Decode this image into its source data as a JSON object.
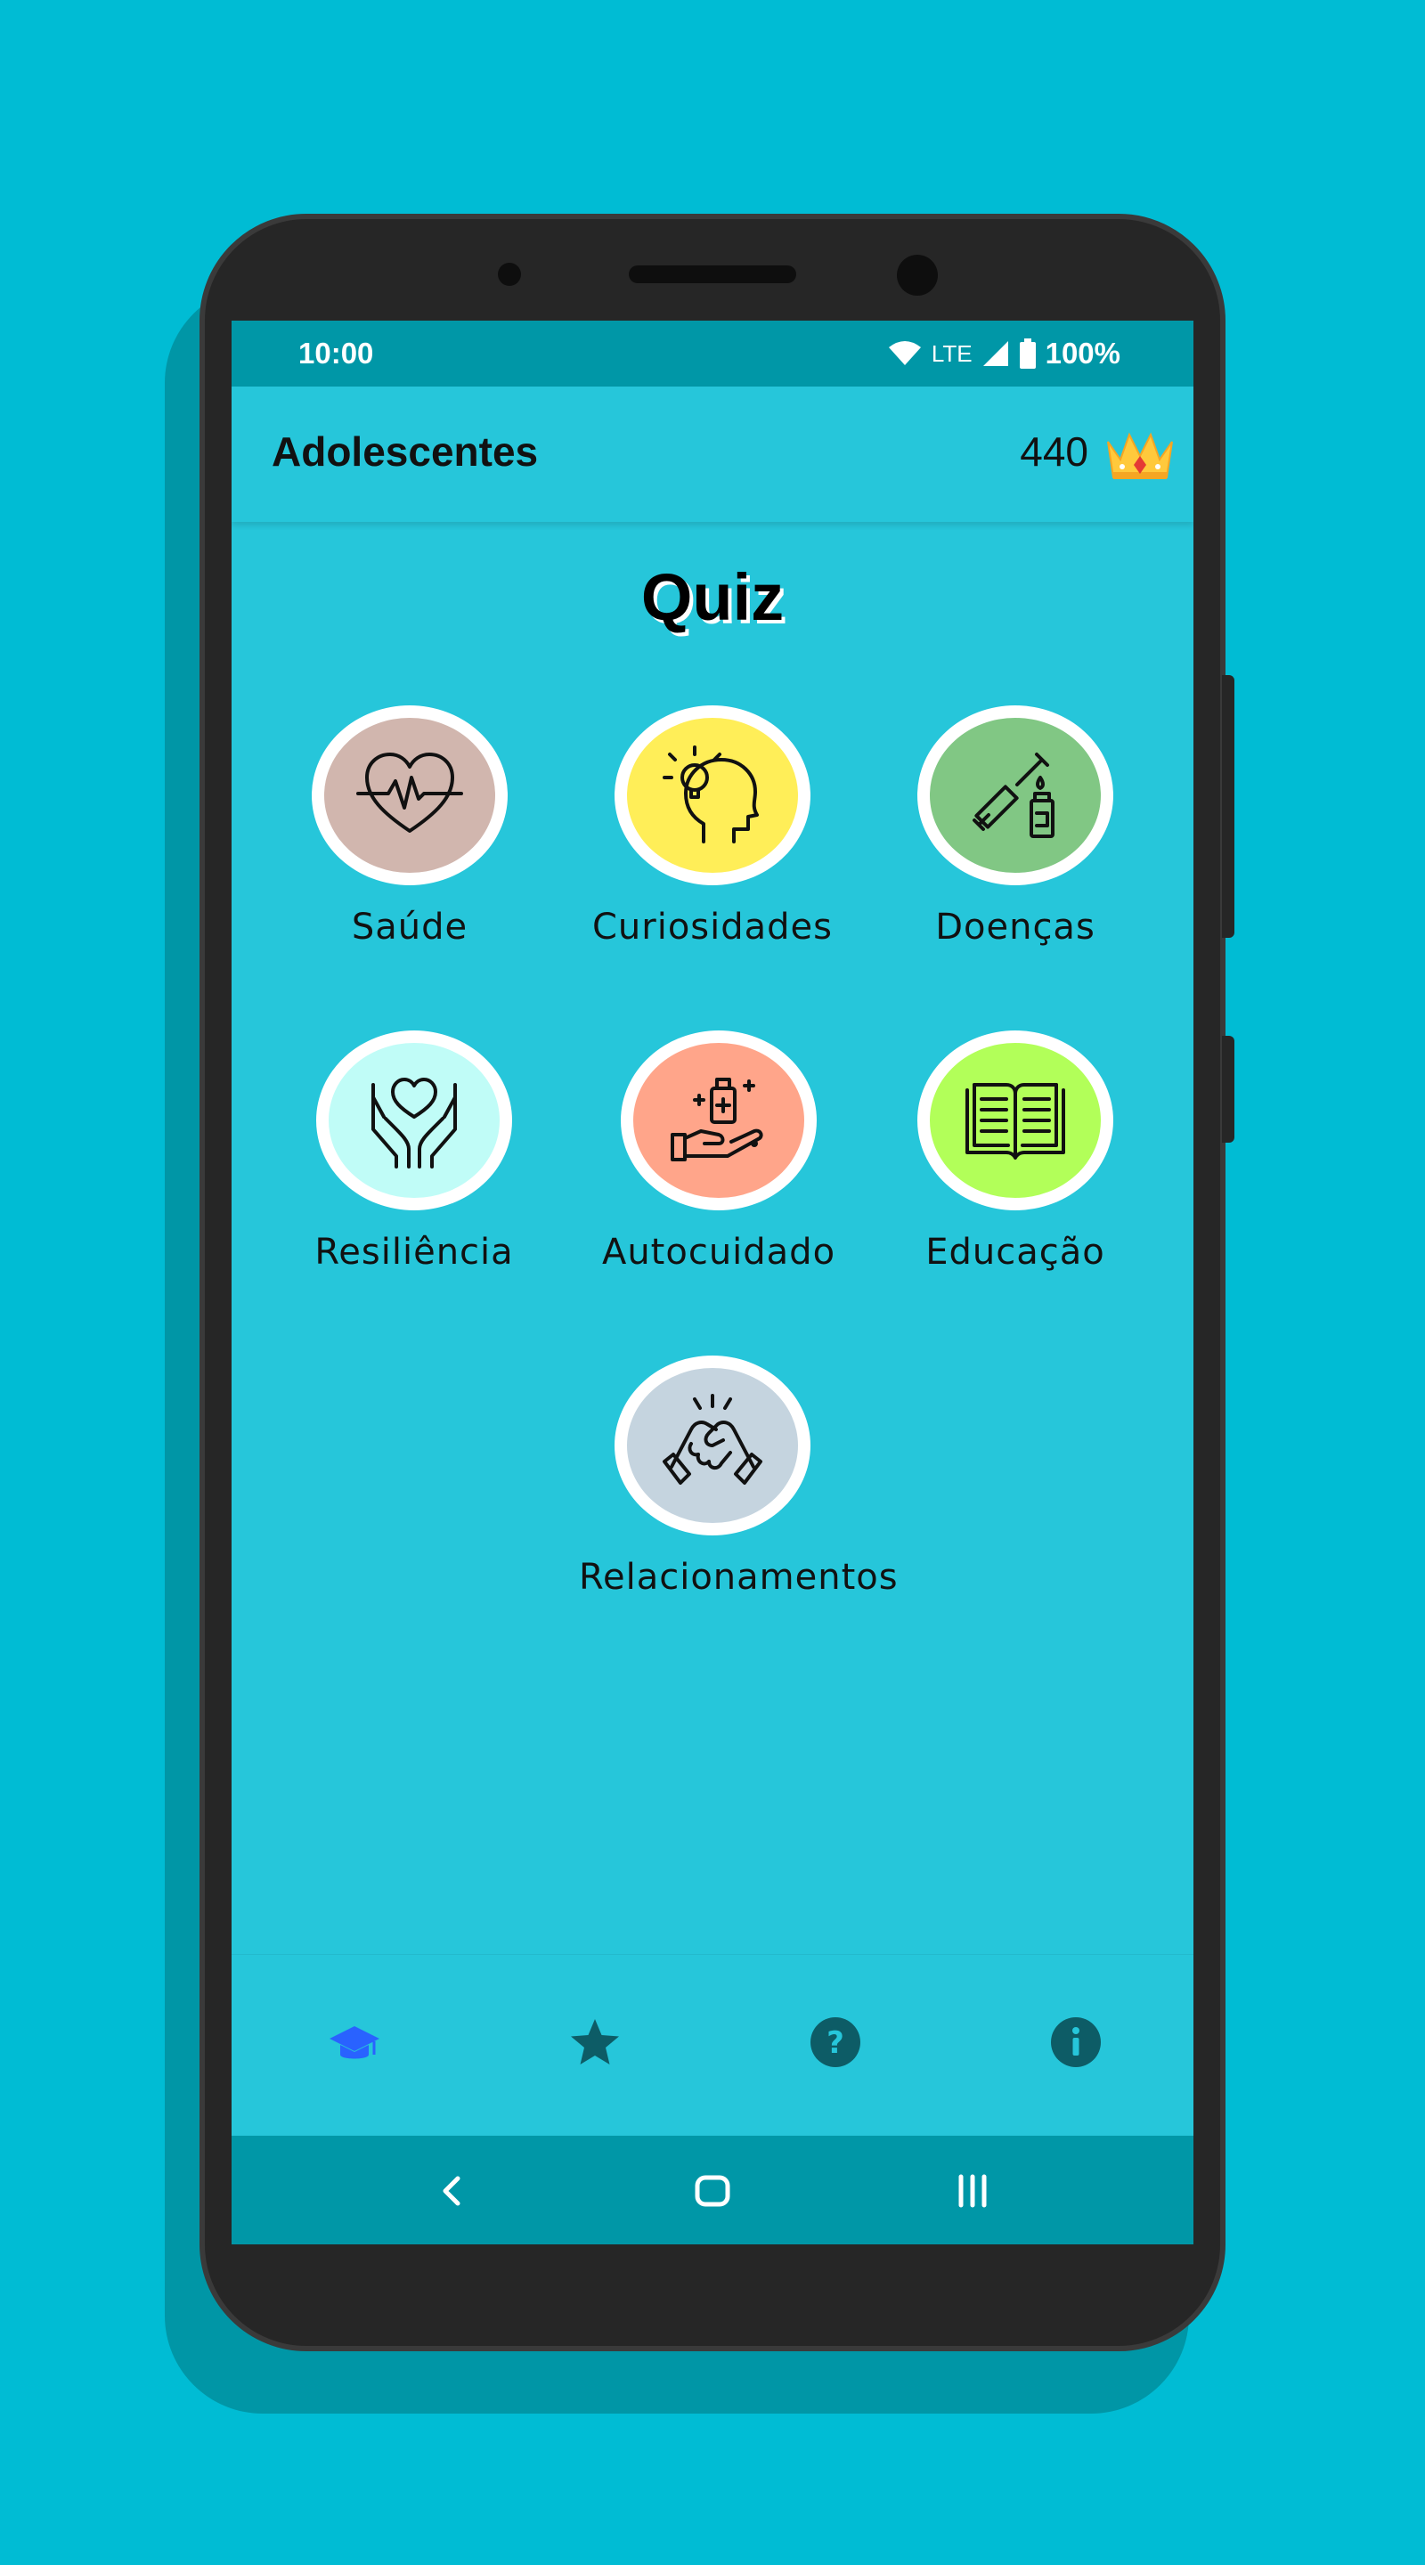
{
  "status_bar": {
    "time": "10:00",
    "network": "LTE",
    "battery": "100%",
    "icons": [
      "wifi-icon",
      "signal-icon",
      "battery-icon"
    ]
  },
  "app_bar": {
    "title": "Adolescentes",
    "score": "440",
    "score_icon": "crown-icon"
  },
  "main": {
    "title": "Quiz",
    "categories": [
      {
        "label": "Saúde",
        "icon": "heartbeat-icon",
        "color": "#D1B6AE"
      },
      {
        "label": "Curiosidades",
        "icon": "idea-head-icon",
        "color": "#FFEE58"
      },
      {
        "label": "Doenças",
        "icon": "syringe-vial-icon",
        "color": "#81C784"
      },
      {
        "label": "Resiliência",
        "icon": "hands-heart-icon",
        "color": "#C0FCF7"
      },
      {
        "label": "Autocuidado",
        "icon": "hand-medicine-icon",
        "color": "#FFA58A"
      },
      {
        "label": "Educação",
        "icon": "open-book-icon",
        "color": "#B2FF59"
      },
      {
        "label": "Relacionamentos",
        "icon": "handshake-icon",
        "color": "#C5D4DF"
      }
    ]
  },
  "bottom_nav": {
    "items": [
      {
        "name": "quiz-tab",
        "icon": "graduation-cap-icon",
        "active": true
      },
      {
        "name": "favorites-tab",
        "icon": "star-icon",
        "active": false
      },
      {
        "name": "help-tab",
        "icon": "question-icon",
        "active": false
      },
      {
        "name": "info-tab",
        "icon": "info-icon",
        "active": false
      }
    ],
    "active_color": "#2962FF",
    "inactive_color": "#0D5C66"
  },
  "colors": {
    "background": "#00BCD4",
    "app_surface": "#26C6DA",
    "status_bar": "#0097A7"
  }
}
